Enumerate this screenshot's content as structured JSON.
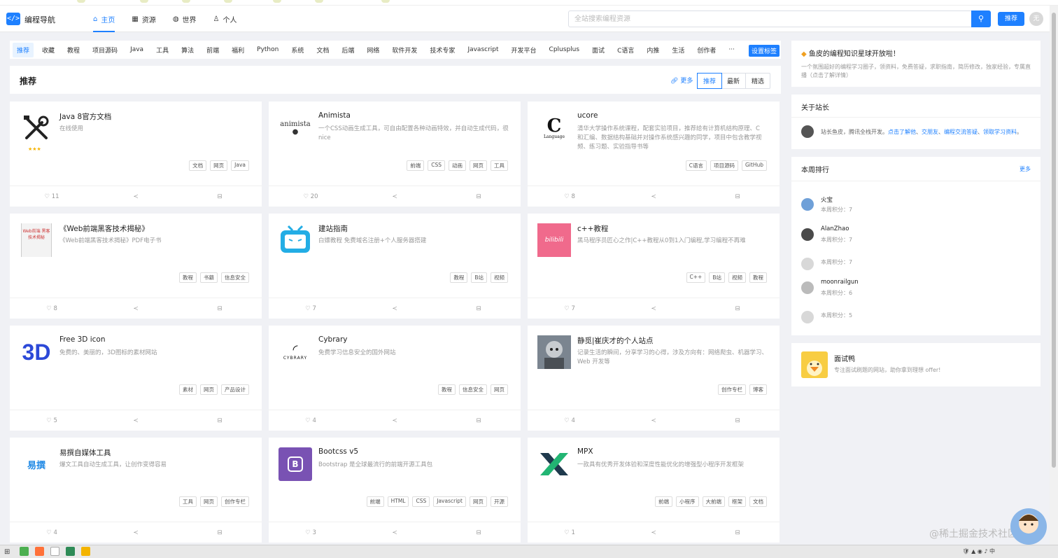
{
  "header": {
    "brand": "编程导航",
    "nav": [
      {
        "label": "主页",
        "icon": "home-icon",
        "active": true
      },
      {
        "label": "资源",
        "icon": "grid-icon",
        "active": false
      },
      {
        "label": "世界",
        "icon": "globe-icon",
        "active": false
      },
      {
        "label": "个人",
        "icon": "user-icon",
        "active": false
      }
    ],
    "search_placeholder": "全站搜索编程资源",
    "recommend_button": "推荐",
    "avatar_text": "无"
  },
  "tags": [
    "推荐",
    "收藏",
    "教程",
    "项目源码",
    "Java",
    "工具",
    "算法",
    "前端",
    "福利",
    "Python",
    "系统",
    "文档",
    "后端",
    "网络",
    "软件开发",
    "技术专家",
    "Javascript",
    "开发平台",
    "Cplusplus",
    "面试",
    "C语言",
    "内推",
    "生活",
    "创作者",
    "···"
  ],
  "tags_settings": "设置标签",
  "recommend": {
    "title": "推荐",
    "more": "更多",
    "sort": [
      "推荐",
      "最新",
      "精选"
    ]
  },
  "cards": [
    {
      "title": "Java 8官方文档",
      "desc": "在线使用",
      "tags": [
        "文档",
        "网页",
        "Java"
      ],
      "likes": "11",
      "icon": "tools-icon",
      "stars": "★★★"
    },
    {
      "title": "Animista",
      "desc": "一个CSS动画生成工具，可自由配置各种动画特效，并自动生成代码，很 nice",
      "tags": [
        "前端",
        "CSS",
        "动画",
        "网页",
        "工具"
      ],
      "likes": "20",
      "icon": "animista-logo",
      "thumb_text": "animista"
    },
    {
      "title": "ucore",
      "desc": "清华大学操作系统课程，配套实验项目，推荐给有计算机结构原理、C 和汇编、数据结构基础并对操作系统感兴趣的同学，项目中包含教学视频、练习题、实验指导书等",
      "tags": [
        "C语言",
        "项目源码",
        "GitHub"
      ],
      "likes": "8",
      "icon": "c-language-logo",
      "thumb_text": "C",
      "thumb_sub": "Language"
    },
    {
      "title": "《Web前端黑客技术揭秘》",
      "desc": "《Web前端黑客技术揭秘》PDF电子书",
      "tags": [
        "教程",
        "书籍",
        "信息安全"
      ],
      "likes": "8",
      "icon": "book-cover",
      "thumb_text": "Web前端 黑客技术揭秘"
    },
    {
      "title": "建站指南",
      "desc": "白嫖教程 免费域名注册+个人服务器搭建",
      "tags": [
        "教程",
        "B站",
        "视频"
      ],
      "likes": "7",
      "icon": "bilibili-tv-icon"
    },
    {
      "title": "c++教程",
      "desc": "黑马程序员匠心之作|C++教程从0到1入门编程,学习编程不再难",
      "tags": [
        "C++",
        "B站",
        "视频",
        "教程"
      ],
      "likes": "7",
      "icon": "bilibili-logo",
      "thumb_text": "bilibili"
    },
    {
      "title": "Free 3D icon",
      "desc": "免费的、美丽的，3D图标的素材网站",
      "tags": [
        "素材",
        "网页",
        "产品设计"
      ],
      "likes": "5",
      "icon": "3d-logo",
      "thumb_text": "3D"
    },
    {
      "title": "Cybrary",
      "desc": "免费学习信息安全的国外网站",
      "tags": [
        "教程",
        "信息安全",
        "网页"
      ],
      "likes": "4",
      "icon": "cybrary-logo",
      "thumb_text": "CYBRARY"
    },
    {
      "title": "静觅|崔庆才的个人站点",
      "desc": "记录生活的瞬间，分享学习的心得，涉及方向有：网络爬虫、机器学习、Web 开发等",
      "tags": [
        "创作专栏",
        "博客"
      ],
      "likes": "4",
      "icon": "portrait-photo"
    },
    {
      "title": "易撰自媒体工具",
      "desc": "爆文工具自动生成工具，让创作变得容易",
      "tags": [
        "工具",
        "网页",
        "创作专栏"
      ],
      "likes": "4",
      "icon": "yizhuan-logo",
      "thumb_text": "易撰"
    },
    {
      "title": "Bootcss v5",
      "desc": "Bootstrap 是全球最流行的前端开源工具包",
      "tags": [
        "前端",
        "HTML",
        "CSS",
        "Javascript",
        "网页",
        "开源"
      ],
      "likes": "3",
      "icon": "bootstrap-logo",
      "thumb_text": "B"
    },
    {
      "title": "MPX",
      "desc": "一款具有优秀开发体验和深度性能优化的增强型小程序开发框架",
      "tags": [
        "前端",
        "小程序",
        "大前端",
        "框架",
        "文档"
      ],
      "likes": "1",
      "icon": "mpx-logo"
    }
  ],
  "sidebar": {
    "planet_title": "鱼皮的编程知识星球开放啦！",
    "planet_desc": "一个氛围超好的编程学习圈子，领资料，免费答疑，求职指南，简历修改，独家经验，专属直播（点击了解详情）",
    "owner_title": "关于站长",
    "owner_text": "站长鱼皮，腾讯全栈开发。",
    "owner_links": [
      "点击了解他",
      "交朋友",
      "编程交流答疑",
      "领取学习资料"
    ],
    "rank_title": "本周排行",
    "rank_more": "更多",
    "rank": [
      {
        "name": "火宝",
        "points": "本周积分：7"
      },
      {
        "name": "AlanZhao",
        "points": "本周积分：7"
      },
      {
        "name": "",
        "points": "本周积分：7"
      },
      {
        "name": "moonrailgun",
        "points": "本周积分：6"
      },
      {
        "name": "",
        "points": "本周积分：5"
      }
    ],
    "ms_title": "面试鸭",
    "ms_desc": "专注面试刷题的网站，助你拿到理想 offer!"
  },
  "watermark": "@稀土掘金技术社区",
  "colors": {
    "accent": "#1e80ff",
    "background": "#f0f1f5"
  }
}
